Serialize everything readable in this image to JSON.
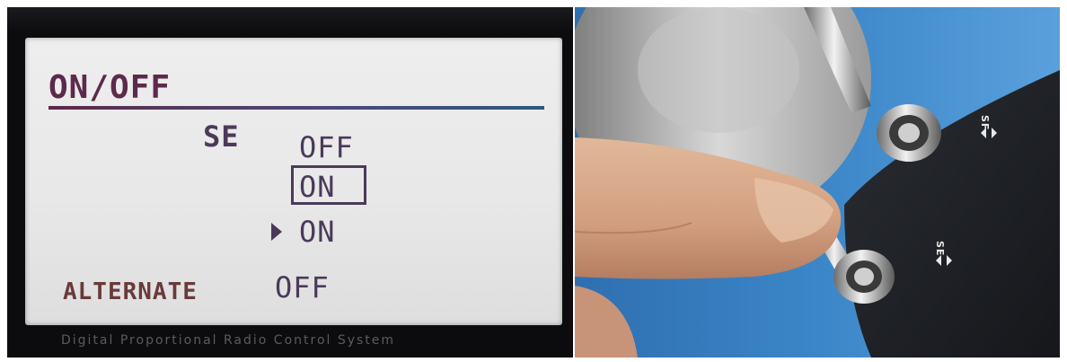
{
  "lcd": {
    "title": "ON/OFF",
    "switch_name": "SE",
    "state_top": "OFF",
    "state_boxed": "ON",
    "state_current": "ON",
    "alternate_label": "ALTERNATE",
    "alternate_value": "OFF"
  },
  "footer": {
    "text": "Digital Proportional Radio Control System"
  },
  "photo": {
    "upper_switch_label": "SF",
    "lower_switch_label": "SE"
  },
  "colors": {
    "lcd_bg": "#e8e8e8",
    "lcd_text": "#4a3a5a",
    "title_color": "#5c2a4a",
    "photo_bg": "#3b86c8"
  }
}
